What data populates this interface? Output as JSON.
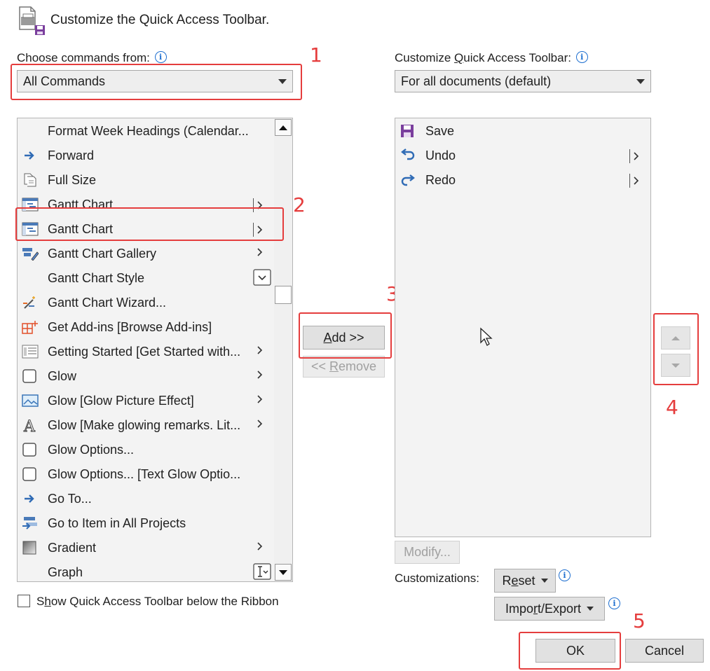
{
  "header": {
    "title": "Customize the Quick Access Toolbar.",
    "icon": "printer-save-icon"
  },
  "left": {
    "choose_label_pre": "Choose commands from:",
    "dropdown_value": "All Commands",
    "items": [
      {
        "label": "Format Week Headings (Calendar...",
        "icon": "none",
        "sub": ""
      },
      {
        "label": "Forward",
        "icon": "arrow-right-icon",
        "sub": ""
      },
      {
        "label": "Full Size",
        "icon": "document-icon",
        "sub": ""
      },
      {
        "label": "Gantt Chart",
        "icon": "gantt-icon",
        "sub": "submenu"
      },
      {
        "label": "Gantt Chart",
        "icon": "gantt-icon",
        "sub": "submenu"
      },
      {
        "label": "Gantt Chart Gallery",
        "icon": "gallery-icon",
        "sub": "arrow"
      },
      {
        "label": "Gantt Chart Style",
        "icon": "none",
        "sub": "dropdown"
      },
      {
        "label": "Gantt Chart Wizard...",
        "icon": "wand-icon",
        "sub": ""
      },
      {
        "label": "Get Add-ins [Browse Add-ins]",
        "icon": "addins-icon",
        "sub": ""
      },
      {
        "label": "Getting Started [Get Started with...",
        "icon": "getting-started-icon",
        "sub": "arrow"
      },
      {
        "label": "Glow",
        "icon": "square-icon",
        "sub": "arrow"
      },
      {
        "label": "Glow [Glow Picture Effect]",
        "icon": "picture-icon",
        "sub": "arrow"
      },
      {
        "label": "Glow [Make glowing remarks. Lit...",
        "icon": "letter-a-icon",
        "sub": "arrow"
      },
      {
        "label": "Glow Options...",
        "icon": "square-icon",
        "sub": ""
      },
      {
        "label": "Glow Options... [Text Glow Optio...",
        "icon": "square-icon",
        "sub": ""
      },
      {
        "label": "Go To...",
        "icon": "arrow-right-icon",
        "sub": ""
      },
      {
        "label": "Go to Item in All Projects",
        "icon": "goto-item-icon",
        "sub": ""
      },
      {
        "label": "Gradient",
        "icon": "gradient-icon",
        "sub": "arrow"
      },
      {
        "label": "Graph",
        "icon": "none",
        "sub": "textbox"
      }
    ],
    "show_below_ribbon": "Show Quick Access Toolbar below the Ribbon"
  },
  "middle": {
    "add": "Add >>",
    "remove": "<< Remove"
  },
  "right": {
    "customize_label": "Customize Quick Access Toolbar:",
    "dropdown_value": "For all documents (default)",
    "items": [
      {
        "label": "Save",
        "icon": "save-icon",
        "sub": ""
      },
      {
        "label": "Undo",
        "icon": "undo-icon",
        "sub": "submenu"
      },
      {
        "label": "Redo",
        "icon": "redo-icon",
        "sub": "submenu"
      }
    ],
    "modify": "Modify...",
    "customizations_label": "Customizations:",
    "reset": "Reset",
    "import_export": "Import/Export"
  },
  "footer": {
    "ok": "OK",
    "cancel": "Cancel"
  },
  "annotations": [
    "1",
    "2",
    "3",
    "4",
    "5"
  ],
  "colors": {
    "annotation_red": "#e53d3d",
    "accent_blue": "#1e6fd0",
    "save_purple": "#7a3e9d"
  }
}
